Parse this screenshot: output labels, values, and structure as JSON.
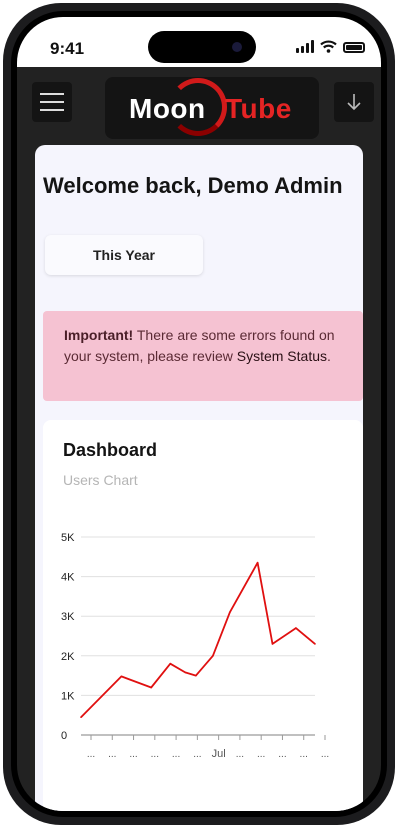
{
  "status_bar": {
    "time": "9:41"
  },
  "app": {
    "logo": {
      "left": "Moon",
      "right": "Tube"
    },
    "menu_icon": "hamburger-icon",
    "download_icon": "arrow-down-icon"
  },
  "welcome": {
    "title": "Welcome back, Demo Admin"
  },
  "filter": {
    "period_label": "This Year"
  },
  "alert": {
    "strong": "Important!",
    "text": " There are some errors found on your system, please review ",
    "link": "System Status",
    "end": "."
  },
  "dashboard": {
    "title": "Dashboard",
    "subtitle": "Users Chart"
  },
  "chart_data": {
    "type": "line",
    "y_ticks": [
      "0",
      "1K",
      "2K",
      "3K",
      "4K",
      "5K"
    ],
    "ylim": [
      0,
      5000
    ],
    "x_tick_labels": [
      "...",
      "...",
      "...",
      "...",
      "...",
      "...",
      "Jul",
      "...",
      "...",
      "...",
      "...",
      "..."
    ],
    "x_count": 12,
    "x_points": [
      0,
      1.9,
      3.3,
      4.2,
      4.9,
      5.4,
      6.2,
      7.0,
      8.3,
      9.0,
      10.1,
      11.0
    ],
    "values": [
      450,
      1480,
      1200,
      1800,
      1580,
      1500,
      2000,
      3100,
      4350,
      2300,
      2700,
      2300
    ],
    "line_color": "#e01010",
    "grid": true
  }
}
